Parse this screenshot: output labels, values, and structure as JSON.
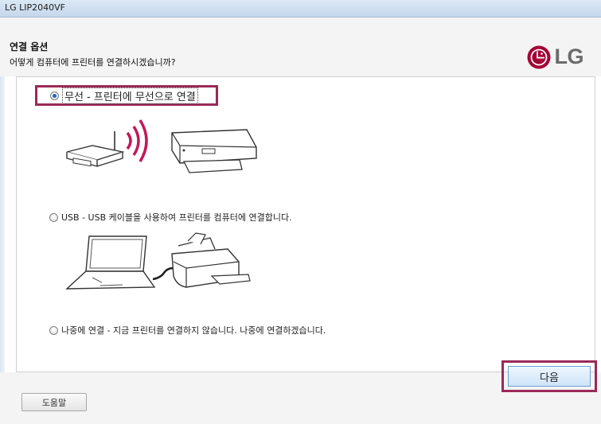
{
  "window": {
    "title": "LG LIP2040VF"
  },
  "header": {
    "heading": "연결 옵션",
    "subheading": "어떻게 컴퓨터에 프린터를 연결하시겠습니까?",
    "logo_text": "LG",
    "logo_color": "#a50034"
  },
  "options": [
    {
      "label": "무선 - 프린터에 무선으로 연결",
      "selected": true
    },
    {
      "label": "USB - USB 케이블을 사용하여 프린터를 컴퓨터에 연결합니다.",
      "selected": false
    },
    {
      "label": "나중에 연결 - 지금 프린터를 연결하지 않습니다. 나중에 연결하겠습니다.",
      "selected": false
    }
  ],
  "footer": {
    "help_label": "도움말",
    "next_label": "다음"
  },
  "colors": {
    "highlight": "#9b2958",
    "wifi_waves": "#c2185b"
  }
}
